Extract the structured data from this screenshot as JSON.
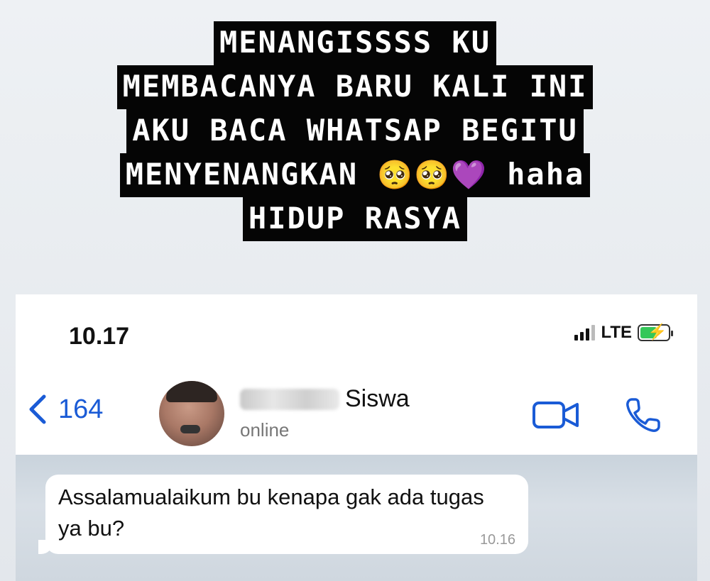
{
  "caption": {
    "line1": "MENANGISSSS KU",
    "line2": "MEMBACANYA BARU KALI INI",
    "line3": "AKU BACA WHATSAP BEGITU",
    "line4_text": "MENYENANGKAN ",
    "line4_emoji1": "🥺",
    "line4_emoji2": "🥺",
    "line4_emoji3": "💜",
    "line4_tail": " haha",
    "line5": "HIDUP RASYA"
  },
  "status_bar": {
    "time": "10.17",
    "network": "LTE"
  },
  "chat_header": {
    "back_count": "164",
    "contact_name_visible": "Siswa",
    "contact_status": "online"
  },
  "messages": [
    {
      "text": "Assalamualaikum bu kenapa gak ada tugas ya bu?",
      "time": "10.16"
    }
  ],
  "colors": {
    "accent": "#1a5bd6",
    "caption_bg": "#050505",
    "caption_text": "#ffffff",
    "battery": "#34c759"
  },
  "icons": [
    "back-chevron-icon",
    "video-call-icon",
    "phone-call-icon",
    "signal-icon",
    "battery-icon"
  ]
}
